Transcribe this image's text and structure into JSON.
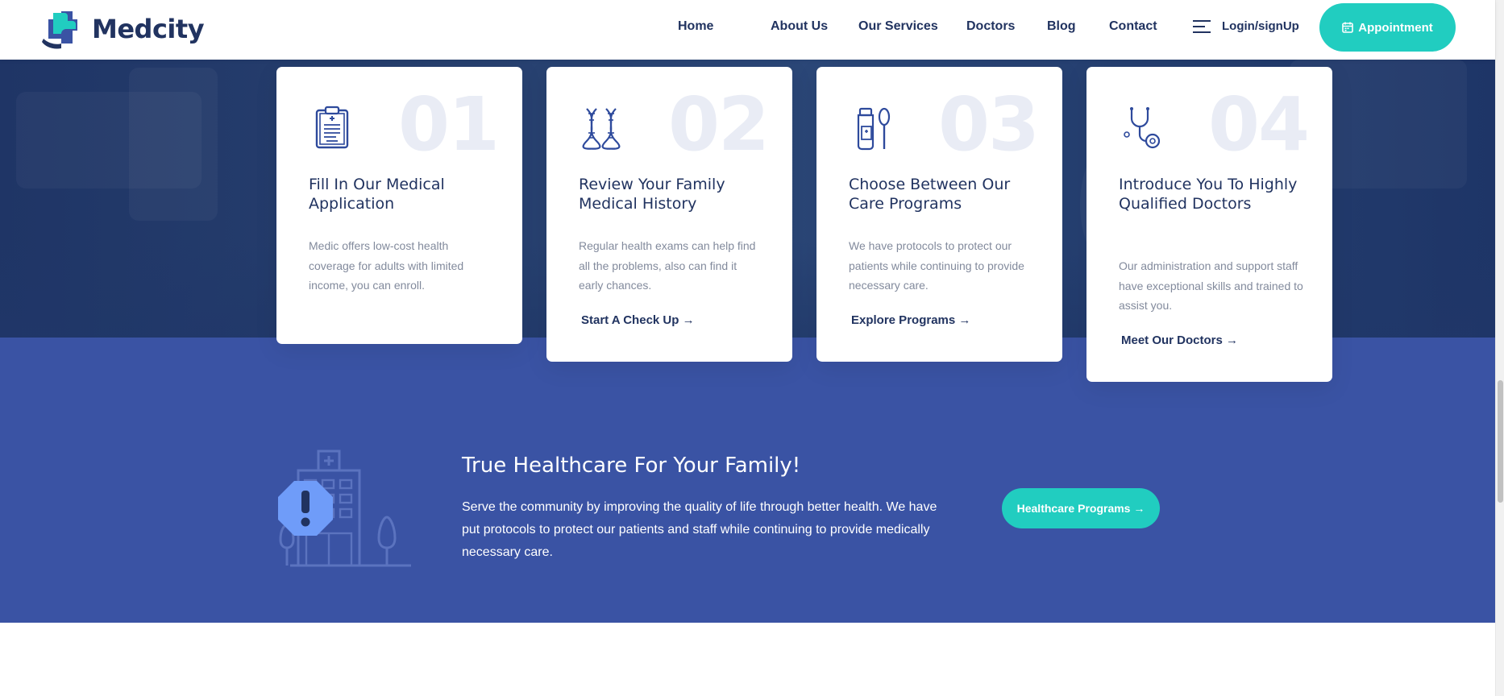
{
  "header": {
    "logo_text": "Medcity",
    "nav": [
      {
        "label": "Home"
      },
      {
        "label": "About Us"
      },
      {
        "label": "Our Services"
      },
      {
        "label": "Doctors"
      },
      {
        "label": "Blog"
      },
      {
        "label": "Contact"
      }
    ],
    "login_label": "Login/signUp",
    "appointment_label": "Appointment"
  },
  "cards": [
    {
      "number": "01",
      "icon": "clipboard-icon",
      "title": "Fill In Our Medical Application",
      "text": "Medic offers low-cost health coverage for adults with limited income, you can enroll.",
      "link": ""
    },
    {
      "number": "02",
      "icon": "dna-icon",
      "title": "Review Your Family Medical History",
      "text": "Regular health exams can help find all the problems, also can find it early chances.",
      "link": "Start A Check Up"
    },
    {
      "number": "03",
      "icon": "medicine-spoon-icon",
      "title": "Choose Between Our Care Programs",
      "text": "We have protocols to protect our patients while continuing to provide necessary care.",
      "link": "Explore Programs"
    },
    {
      "number": "04",
      "icon": "stethoscope-icon",
      "title": "Introduce You To Highly Qualified Doctors",
      "text": "Our administration and support staff have exceptional skills and trained to assist you.",
      "link": "Meet Our Doctors"
    }
  ],
  "cta": {
    "title": "True Healthcare For Your Family!",
    "text": "Serve the community by improving the quality of life through better health. We have put protocols to protect our patients and staff while continuing to provide medically necessary care.",
    "button_label": "Healthcare Programs"
  },
  "colors": {
    "brand_dark": "#213360",
    "accent_teal": "#21cdc0",
    "band_blue": "#3a53a4",
    "alert_blue": "#6f9cf9"
  }
}
